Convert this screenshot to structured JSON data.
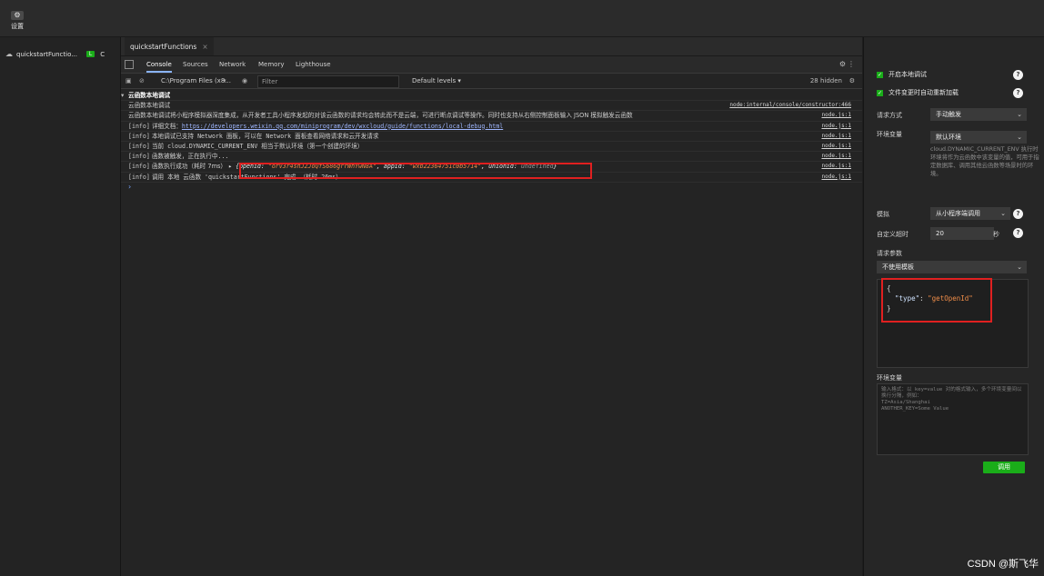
{
  "topbar": {
    "settings_icon": "gear-icon",
    "settings_label": "设置"
  },
  "left_panel": {
    "function_name": "quickstartFunctio...",
    "badge_local": "L",
    "badge_cloud": "C"
  },
  "editor_tab": {
    "title": "quickstartFunctions",
    "close": "×"
  },
  "devtools": {
    "tabs": [
      "Console",
      "Sources",
      "Network",
      "Memory",
      "Lighthouse"
    ],
    "active_tab": "Console",
    "context": "C:\\Program Files (x8...",
    "filter_placeholder": "Filter",
    "levels": "Default levels ▾",
    "hidden_count": "28 hidden"
  },
  "console": {
    "group_title": "云函数本地调试",
    "rows": [
      {
        "text": "云函数本地调试",
        "src": "node:internal/console/constructor:466"
      },
      {
        "text": "云函数本地调试将小程序模拟器深度集成，从开发者工具小程序发起的对该云函数的请求均会转此而不是云端，可进行断点调试等操作。同时也支持从右侧控制面板输入 JSON 模拟触发云函数",
        "src": "node.js:1"
      },
      {
        "info": "[info]",
        "text_prefix": "详细文档：",
        "link": "https://developers.weixin.qq.com/miniprogram/dev/wxcloud/guide/functions/local-debug.html",
        "src": "node.js:1"
      },
      {
        "info": "[info]",
        "text": "本地调试已支持 Network 面板，可以在 Network 面板查看网络请求和云开发请求",
        "src": "node.js:1"
      },
      {
        "info": "[info]",
        "text": "当前 cloud.DYNAMIC_CURRENT_ENV 相当于默认环境（第一个创建的环境）",
        "src": "node.js:1"
      },
      {
        "info": "[info]",
        "text": "函数被触发，正在执行中...",
        "src": "node.js:1"
      },
      {
        "info": "[info]",
        "text_prefix": "函数执行成功（耗时 7ms）",
        "obj_openid_key": "openid:",
        "obj_openid": "\"orV3r4shJ2JoQfS686grrWhYwN8A\"",
        "obj_appid_key": "appid:",
        "obj_appid": "\"wxb22364751c0b5714\"",
        "obj_unionid_key": "unionid:",
        "obj_unionid": "undefined",
        "src": "node.js:1"
      },
      {
        "info": "[info]",
        "text": "调用 本地 云函数 'quickstartFunctions' 完成 （耗时 26ms）",
        "src": "node.js:1"
      }
    ],
    "prompt": "›"
  },
  "right_panel": {
    "enable_local_debug": "开启本地调试",
    "hot_reload": "文件变更时自动重新加载",
    "request_mode_label": "请求方式",
    "request_mode_value": "手动触发",
    "env_label": "环境变量",
    "env_value": "默认环境",
    "env_desc": "cloud.DYNAMIC_CURRENT_ENV 执行时环境将作为云函数中该变量的值，可用于指定数据库、调用其他云函数等场景时的环境。",
    "simulate_label": "模拟",
    "simulate_value": "从小程序端调用",
    "timeout_label": "自定义超时",
    "timeout_value": "20",
    "timeout_unit": "秒",
    "params_label": "请求参数",
    "template_value": "不使用模板",
    "params_code_open": "{",
    "params_key": "\"type\"",
    "params_colon": ": ",
    "params_val": "\"getOpenId\"",
    "params_code_close": "}",
    "env_vars_label": "环境变量",
    "env_vars_placeholder": "输入格式：以 key=value 对的格式输入，多个环境变量间以换行分隔，例如：\nTZ=Asia/Shanghai\nANOTHER_KEY=Some Value",
    "call_button": "调用"
  },
  "watermark": "CSDN @斯飞华"
}
